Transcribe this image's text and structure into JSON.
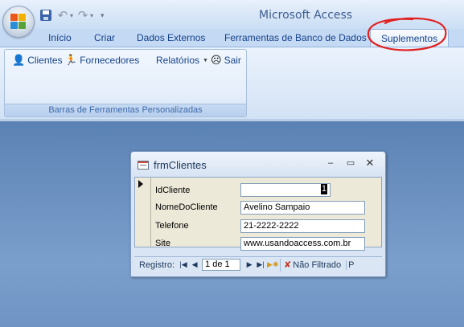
{
  "window": {
    "title": "Microsoft Access"
  },
  "quick_access": {
    "buttons": [
      {
        "icon": "save-icon"
      },
      {
        "icon": "undo-icon"
      },
      {
        "icon": "redo-icon"
      },
      {
        "icon": "customize-dropdown-icon"
      }
    ]
  },
  "tabs": [
    {
      "label": "Início"
    },
    {
      "label": "Criar"
    },
    {
      "label": "Dados Externos"
    },
    {
      "label": "Ferramentas de Banco de Dados"
    },
    {
      "label": "Suplementos",
      "selected": true
    }
  ],
  "ribbon": {
    "group_caption": "Barras de Ferramentas Personalizadas",
    "items": [
      {
        "label": "Clientes",
        "icon": "person-icon"
      },
      {
        "label": "Fornecedores",
        "icon": "runner-icon"
      },
      {
        "label": "Relatórios",
        "icon": "dropdown-caret-icon"
      },
      {
        "label": "Sair",
        "icon": "frown-face-icon"
      }
    ]
  },
  "form": {
    "title": "frmClientes",
    "fields": [
      {
        "label": "IdCliente",
        "value": "1"
      },
      {
        "label": "NomeDoCliente",
        "value": "Avelino Sampaio"
      },
      {
        "label": "Telefone",
        "value": "21-2222-2222"
      },
      {
        "label": "Site",
        "value": "www.usandoaccess.com.br"
      }
    ],
    "navigation": {
      "label": "Registro:",
      "record": "1 de 1",
      "filter": "Não Filtrado",
      "search": "P"
    }
  },
  "colors": {
    "annotation_circle": "#e02020",
    "workspace": "#6e93c2",
    "ribbon_text": "#15428b"
  }
}
